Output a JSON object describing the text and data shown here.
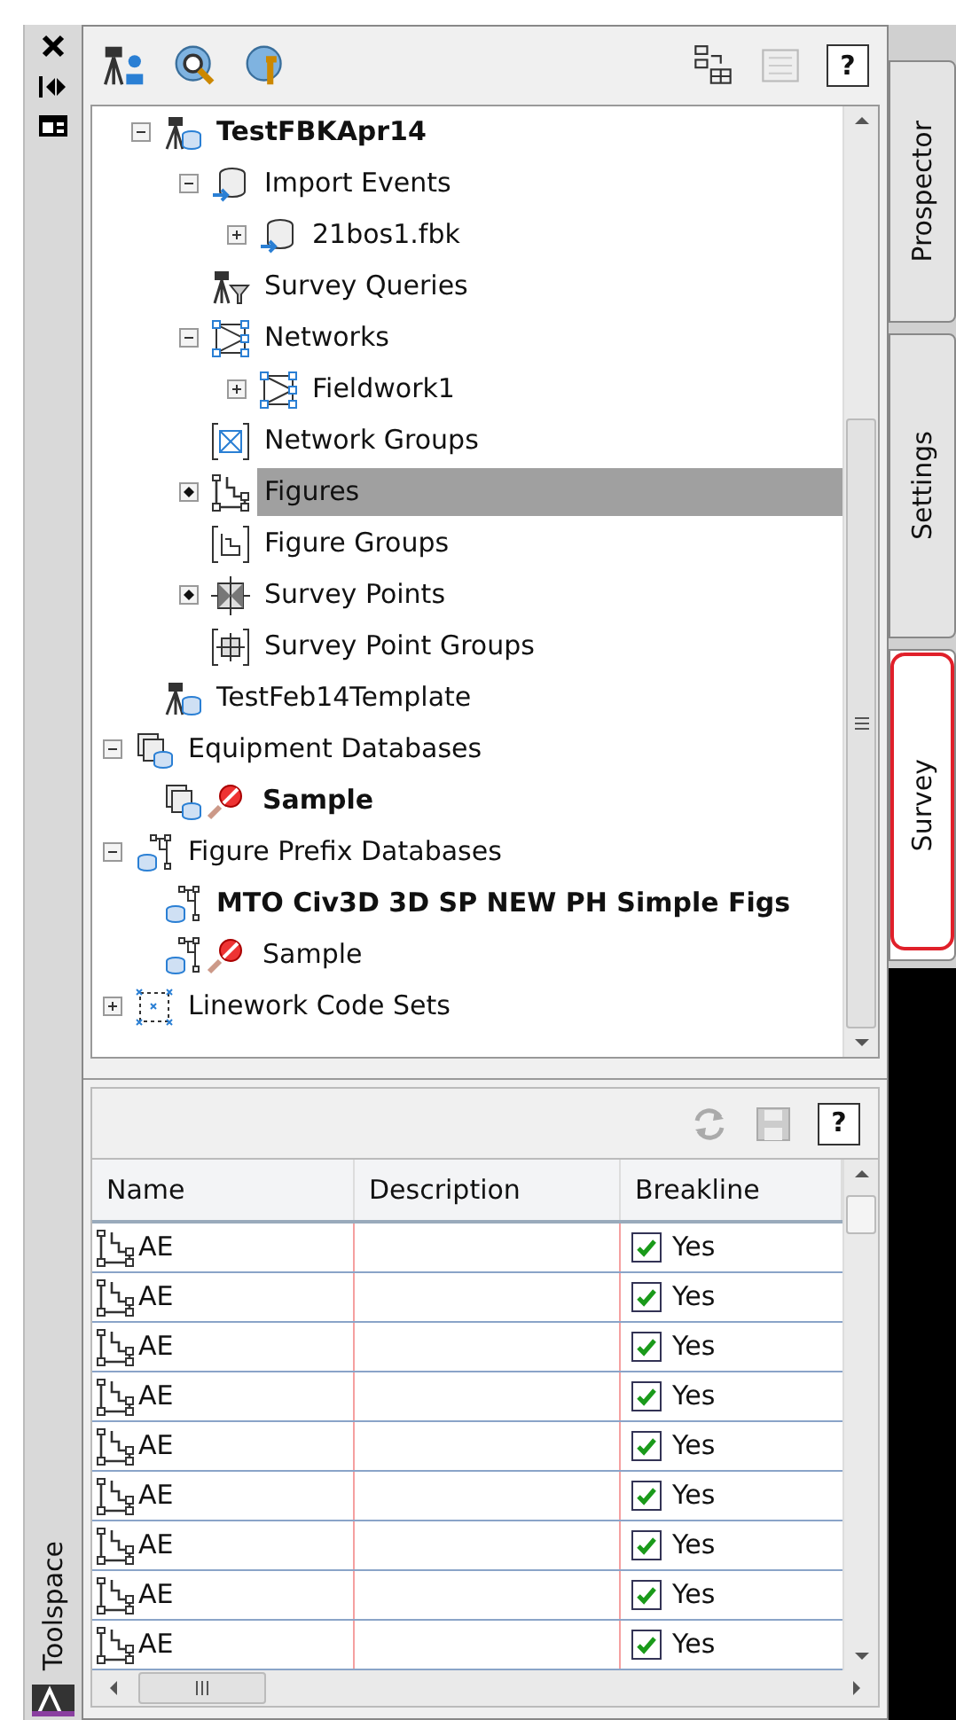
{
  "side_strip": {
    "title": "Toolspace"
  },
  "toolbar": {
    "help_label": "?"
  },
  "tree": {
    "items": [
      {
        "children": [
          {
            "label": "TestFBKApr14",
            "kind": "survey-db",
            "expanded": true,
            "bold": true,
            "locked": false,
            "selected": false,
            "children": [
              {
                "label": "Import Events",
                "kind": "import",
                "expanded": true,
                "bold": false,
                "locked": false,
                "selected": false,
                "children": [
                  {
                    "label": "21bos1.fbk",
                    "kind": "import",
                    "expanded": false,
                    "bold": false,
                    "locked": false,
                    "selected": false
                  }
                ]
              },
              {
                "label": "Survey Queries",
                "kind": "query",
                "bold": false,
                "locked": false,
                "selected": false
              },
              {
                "label": "Networks",
                "kind": "network",
                "expanded": true,
                "bold": false,
                "locked": false,
                "selected": false,
                "children": [
                  {
                    "label": "Fieldwork1",
                    "kind": "network",
                    "expanded": false,
                    "bold": false,
                    "locked": false,
                    "selected": false
                  }
                ]
              },
              {
                "label": "Network Groups",
                "kind": "network-group",
                "bold": false,
                "locked": false,
                "selected": false
              },
              {
                "label": "Figures",
                "kind": "figure",
                "list_dot": true,
                "bold": false,
                "locked": false,
                "selected": true
              },
              {
                "label": "Figure Groups",
                "kind": "figure-group",
                "bold": false,
                "locked": false,
                "selected": false
              },
              {
                "label": "Survey Points",
                "kind": "point",
                "list_dot": true,
                "bold": false,
                "locked": false,
                "selected": false
              },
              {
                "label": "Survey Point Groups",
                "kind": "point-group",
                "bold": false,
                "locked": false,
                "selected": false
              }
            ]
          },
          {
            "label": "TestFeb14Template",
            "kind": "survey-db",
            "bold": false,
            "locked": false,
            "selected": false
          }
        ]
      },
      {
        "label": "Equipment Databases",
        "kind": "equipment",
        "expanded": true,
        "bold": false,
        "locked": false,
        "selected": false,
        "children": [
          {
            "label": "Sample",
            "kind": "equipment",
            "bold": true,
            "locked": true,
            "selected": false
          }
        ]
      },
      {
        "label": "Figure Prefix Databases",
        "kind": "prefix-db",
        "expanded": true,
        "bold": false,
        "locked": false,
        "selected": false,
        "children": [
          {
            "label": "MTO Civ3D 3D SP NEW PH Simple Figs",
            "kind": "prefix-db",
            "bold": true,
            "locked": false,
            "selected": false
          },
          {
            "label": "Sample",
            "kind": "prefix-db",
            "bold": false,
            "locked": true,
            "selected": false
          }
        ]
      },
      {
        "label": "Linework Code Sets",
        "kind": "linework",
        "expanded": false,
        "bold": false,
        "locked": false,
        "selected": false
      }
    ]
  },
  "list_toolbar": {
    "help_label": "?"
  },
  "grid": {
    "columns": [
      "Name",
      "Description",
      "Breakline"
    ],
    "rows": [
      {
        "name": "AE",
        "breakline": "Yes",
        "breakline_checked": true
      },
      {
        "name": "AE",
        "breakline": "Yes",
        "breakline_checked": true
      },
      {
        "name": "AE",
        "breakline": "Yes",
        "breakline_checked": true
      },
      {
        "name": "AE",
        "breakline": "Yes",
        "breakline_checked": true
      },
      {
        "name": "AE",
        "breakline": "Yes",
        "breakline_checked": true
      },
      {
        "name": "AE",
        "breakline": "Yes",
        "breakline_checked": true
      },
      {
        "name": "AE",
        "breakline": "Yes",
        "breakline_checked": true
      },
      {
        "name": "AE",
        "breakline": "Yes",
        "breakline_checked": true
      },
      {
        "name": "AE",
        "breakline": "Yes",
        "breakline_checked": true
      }
    ]
  },
  "side_tabs": [
    {
      "label": "Prospector",
      "selected": false
    },
    {
      "label": "Settings",
      "selected": false
    },
    {
      "label": "Survey",
      "selected": true,
      "annotated": true
    }
  ]
}
